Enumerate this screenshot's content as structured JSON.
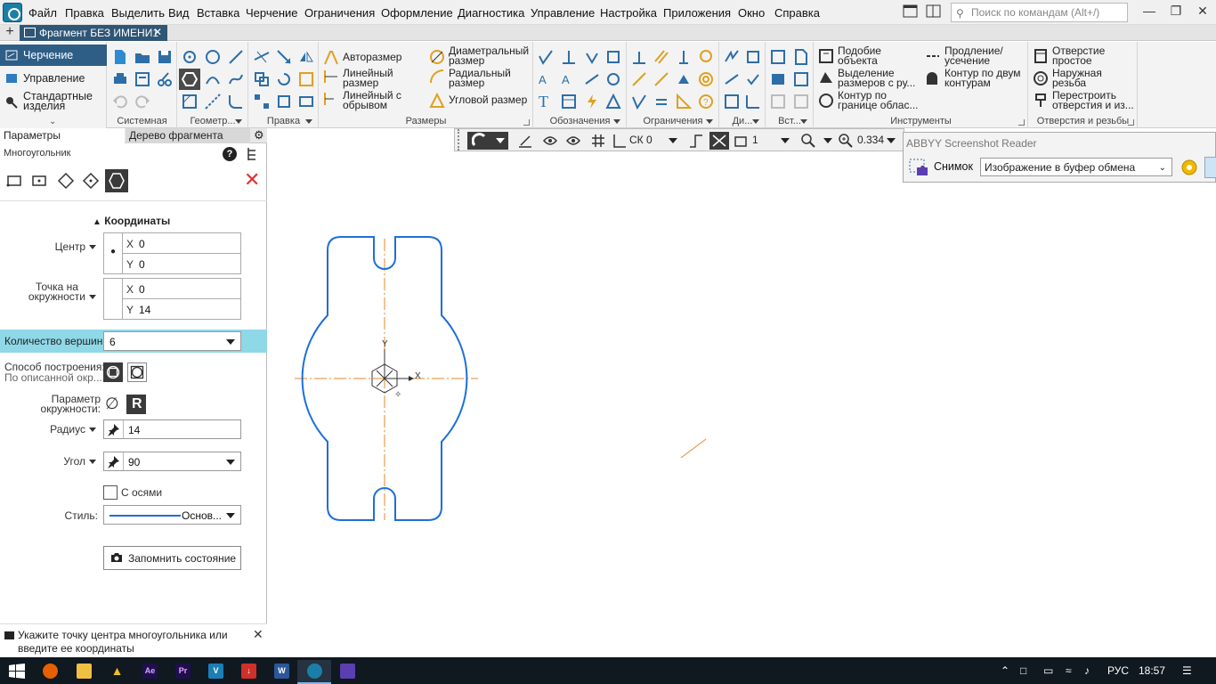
{
  "menubar": {
    "items": [
      "Файл",
      "Правка",
      "Выделить",
      "Вид",
      "Вставка",
      "Черчение",
      "Ограничения",
      "Оформление",
      "Диагностика",
      "Управление",
      "Настройка",
      "Приложения",
      "Окно",
      "Справка"
    ],
    "search_placeholder": "Поиск по командам (Alt+/)"
  },
  "tabbar": {
    "doc_title": "Фрагмент БЕЗ ИМЕНИ1"
  },
  "ribbon": {
    "modes": [
      "Черчение",
      "Управление",
      "Стандартные изделия"
    ],
    "groups": {
      "system": "Системная",
      "geometry": "Геометр...",
      "edit": "Правка",
      "dimensions": "Размеры",
      "designations": "Обозначения",
      "constraints": "Ограничения",
      "di": "Ди...",
      "insert": "Вст...",
      "tools": "Инструменты",
      "holes": "Отверстия и резьбы"
    },
    "dim_buttons": {
      "auto": "Авторазмер",
      "linear": "Линейный размер",
      "linear_break": "Линейный с обрывом",
      "diametral": "Диаметральный размер",
      "radial": "Радиальный размер",
      "angular": "Угловой размер"
    },
    "tool_buttons": {
      "similar": "Подобие объекта",
      "select_dims": "Выделение размеров с ру...",
      "contour_boundary": "Контур по границе облас...",
      "extend": "Продление/ усечение",
      "contour_two": "Контур по двум контурам"
    },
    "hole_buttons": {
      "simple": "Отверстие простое",
      "thread": "Наружная резьба",
      "rebuild": "Перестроить отверстия и из..."
    }
  },
  "panel": {
    "tab_params": "Параметры",
    "tab_tree": "Дерево фрагмента",
    "title": "Многоугольник",
    "coords_header": "Координаты",
    "center_label": "Центр",
    "center": {
      "x": "0",
      "y": "0"
    },
    "point_label_1": "Точка на",
    "point_label_2": "окружности",
    "point": {
      "x": "0",
      "y": "14"
    },
    "vertices_label": "Количество вершин:",
    "vertices_value": "6",
    "method_label_1": "Способ построения:",
    "method_label_2": "По описанной окр...",
    "circle_param_1": "Параметр",
    "circle_param_2": "окружности:",
    "radius_label": "Радиус",
    "radius_value": "14",
    "angle_label": "Угол",
    "angle_value": "90",
    "with_axes_label": "С осями",
    "style_label": "Стиль:",
    "style_value": "Основ...",
    "remember_label": "Запомнить состояние",
    "axis_x": "X",
    "axis_y": "Y",
    "r_glyph": "R",
    "diam_glyph": "∅"
  },
  "status": {
    "text": "Укажите точку центра многоугольника или введите ее координаты"
  },
  "float_toolbar": {
    "cs_label": "СК 0",
    "layer_value": "1",
    "zoom_value": "0.334"
  },
  "abbyy": {
    "title": "ABBYY Screenshot Reader",
    "snapshot_label": "Снимок",
    "target_value": "Изображение в буфер обмена"
  },
  "canvas": {
    "axis_label_x": "X",
    "axis_label_y": "Y"
  },
  "taskbar": {
    "lang": "РУС",
    "time": "18:57"
  },
  "colors": {
    "accent": "#2e5e86",
    "contour": "#1e6fd9",
    "centerline": "#e38a2a",
    "highlight_row": "#8fd8e8"
  }
}
